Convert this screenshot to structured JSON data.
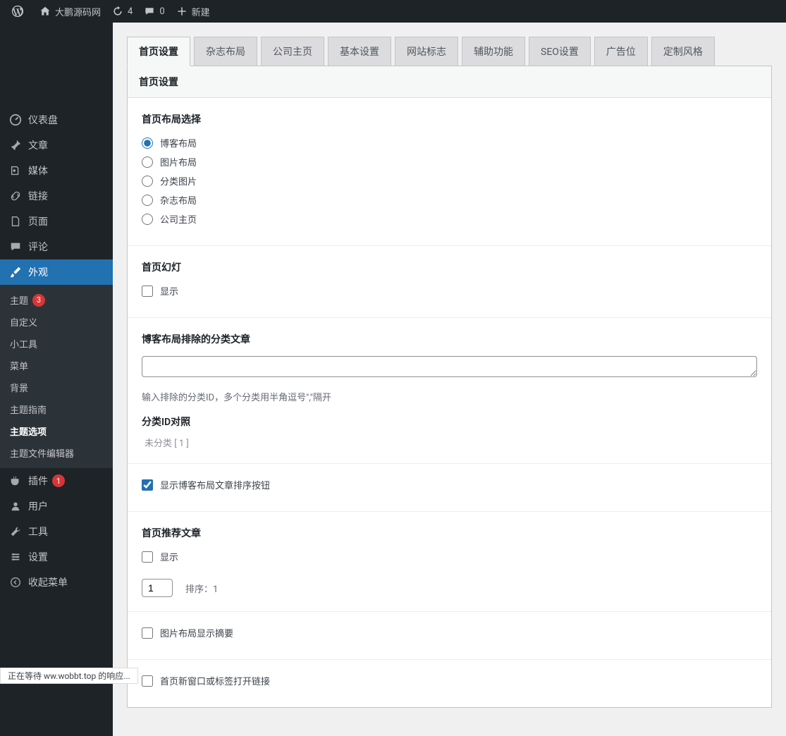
{
  "adminbar": {
    "site_name": "大鹏源码网",
    "updates_count": "4",
    "comments_count": "0",
    "new_label": "新建"
  },
  "sidebar": {
    "items": [
      {
        "label": "仪表盘"
      },
      {
        "label": "文章"
      },
      {
        "label": "媒体"
      },
      {
        "label": "链接"
      },
      {
        "label": "页面"
      },
      {
        "label": "评论"
      },
      {
        "label": "外观"
      },
      {
        "label": "插件",
        "badge": "1"
      },
      {
        "label": "用户"
      },
      {
        "label": "工具"
      },
      {
        "label": "设置"
      },
      {
        "label": "收起菜单"
      }
    ],
    "appearance_submenu": [
      {
        "label": "主题",
        "badge": "3"
      },
      {
        "label": "自定义"
      },
      {
        "label": "小工具"
      },
      {
        "label": "菜单"
      },
      {
        "label": "背景"
      },
      {
        "label": "主题指南"
      },
      {
        "label": "主题选项"
      },
      {
        "label": "主题文件编辑器"
      }
    ]
  },
  "tabs": [
    {
      "label": "首页设置",
      "active": true
    },
    {
      "label": "杂志布局"
    },
    {
      "label": "公司主页"
    },
    {
      "label": "基本设置"
    },
    {
      "label": "网站标志"
    },
    {
      "label": "辅助功能"
    },
    {
      "label": "SEO设置"
    },
    {
      "label": "广告位"
    },
    {
      "label": "定制风格"
    }
  ],
  "panel": {
    "header": "首页设置",
    "layout_title": "首页布局选择",
    "layout_options": [
      "博客布局",
      "图片布局",
      "分类图片",
      "杂志布局",
      "公司主页"
    ],
    "layout_selected": 0,
    "slider_title": "首页幻灯",
    "slider_show_label": "显示",
    "exclude_title": "博客布局排除的分类文章",
    "exclude_hint": "输入排除的分类ID，多个分类用半角逗号\",\"隔开",
    "catid_title": "分类ID对照",
    "catid_text": "未分类 [ 1 ]",
    "sort_btn_label": "显示博客布局文章排序按钮",
    "sort_btn_checked": true,
    "featured_title": "首页推荐文章",
    "featured_show_label": "显示",
    "featured_num_value": "1",
    "featured_order_label": "排序：",
    "featured_order_value": "1",
    "img_summary_label": "图片布局显示摘要",
    "new_window_label": "首页新窗口或标签打开链接"
  },
  "statusbar": "正在等待 ww.wobbt.top 的响应..."
}
